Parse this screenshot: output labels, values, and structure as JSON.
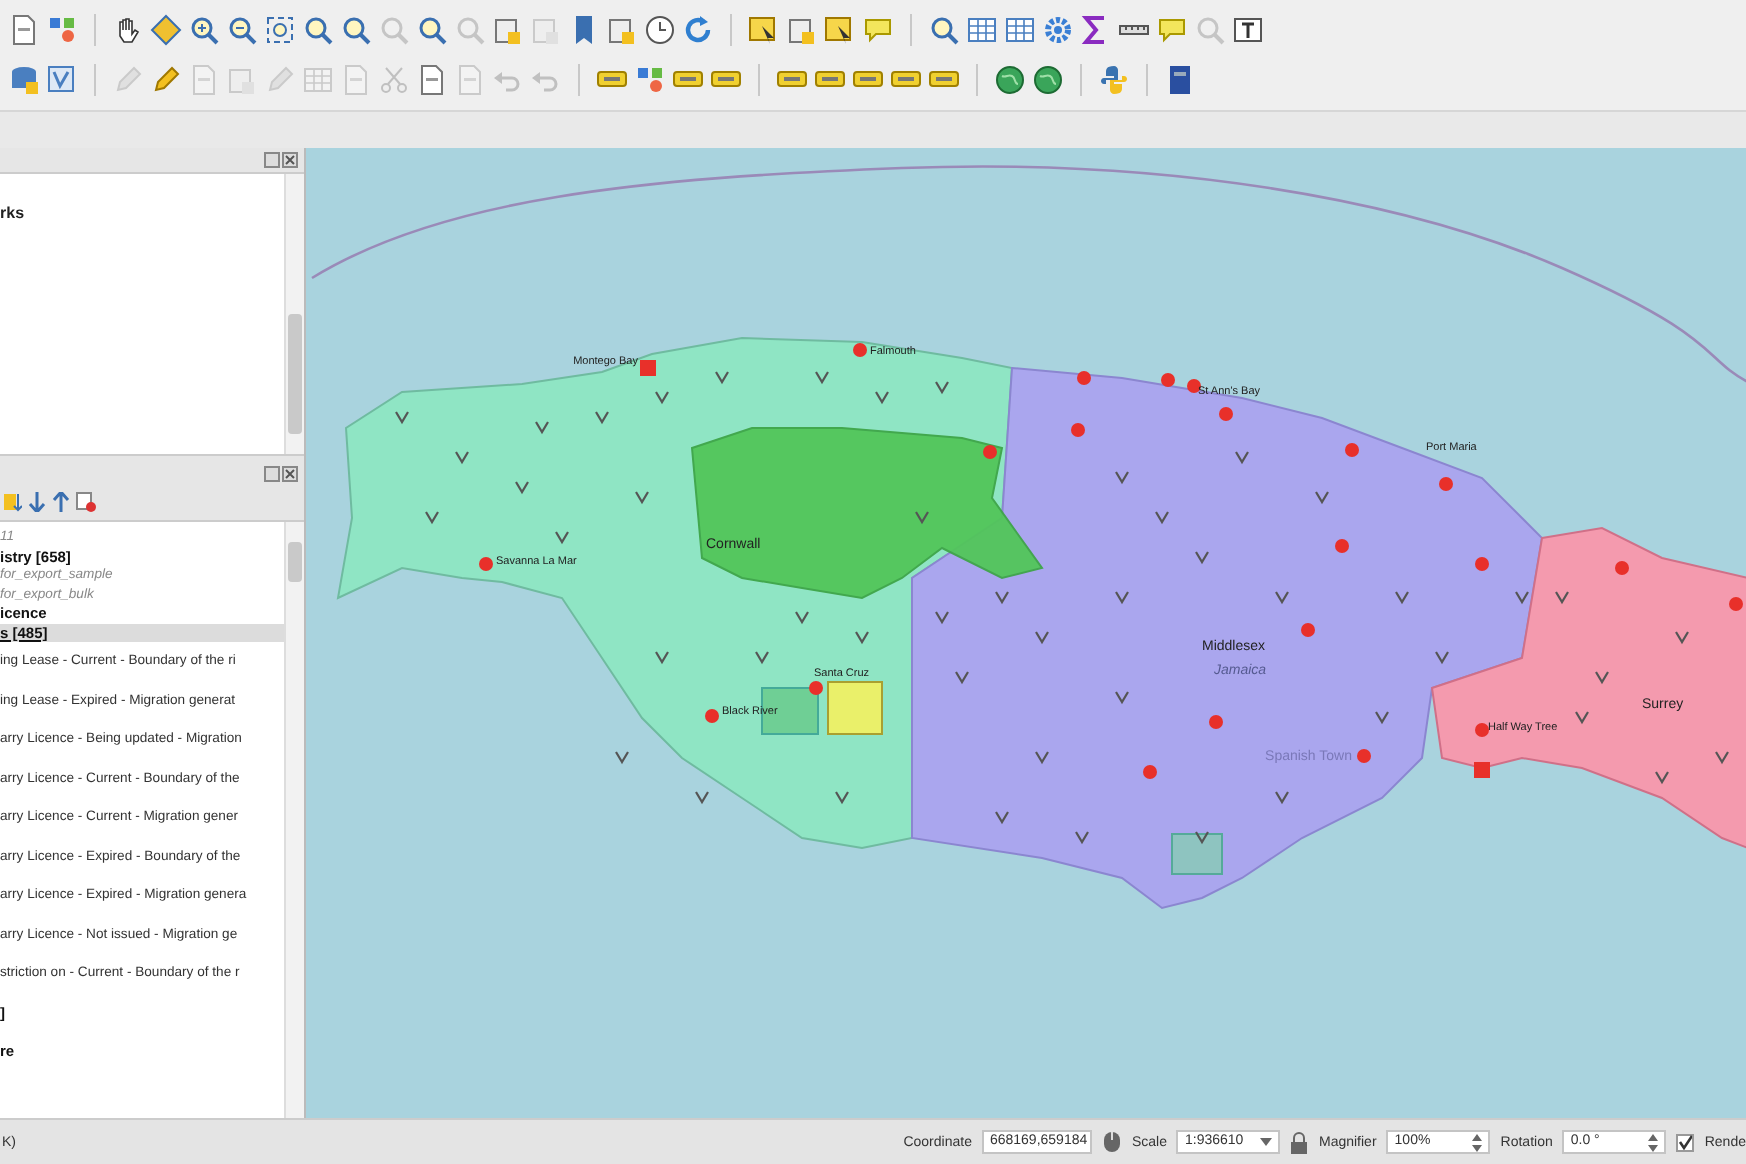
{
  "toolbars": [
    [
      {
        "kind": "page",
        "disabled": false
      },
      {
        "kind": "style",
        "disabled": false
      },
      {
        "kind": "separator"
      },
      {
        "kind": "hand",
        "disabled": false
      },
      {
        "kind": "diamond",
        "disabled": false
      },
      {
        "kind": "zoom-in",
        "disabled": false
      },
      {
        "kind": "zoom-out",
        "disabled": false
      },
      {
        "kind": "extent",
        "disabled": false
      },
      {
        "kind": "mag",
        "disabled": false
      },
      {
        "kind": "mag",
        "disabled": false
      },
      {
        "kind": "mag",
        "disabled": true
      },
      {
        "kind": "mag",
        "disabled": false
      },
      {
        "kind": "mag",
        "disabled": true
      },
      {
        "kind": "layer",
        "disabled": false
      },
      {
        "kind": "layer",
        "disabled": true
      },
      {
        "kind": "bookmark",
        "disabled": false
      },
      {
        "kind": "layer",
        "disabled": false
      },
      {
        "kind": "clock",
        "disabled": false
      },
      {
        "kind": "refresh",
        "disabled": false
      },
      {
        "kind": "separator"
      },
      {
        "kind": "select",
        "disabled": false
      },
      {
        "kind": "layer",
        "disabled": false
      },
      {
        "kind": "select",
        "disabled": false
      },
      {
        "kind": "bubble",
        "disabled": false
      },
      {
        "kind": "separator"
      },
      {
        "kind": "info",
        "disabled": false
      },
      {
        "kind": "table",
        "disabled": false
      },
      {
        "kind": "table",
        "disabled": false
      },
      {
        "kind": "gear",
        "disabled": false
      },
      {
        "kind": "sigma",
        "disabled": false
      },
      {
        "kind": "ruler",
        "disabled": false
      },
      {
        "kind": "bubble",
        "disabled": false
      },
      {
        "kind": "mag",
        "disabled": true
      },
      {
        "kind": "textbox",
        "disabled": false
      }
    ],
    [
      {
        "kind": "database",
        "disabled": false
      },
      {
        "kind": "vector",
        "disabled": false
      },
      {
        "kind": "separator"
      },
      {
        "kind": "pencil",
        "disabled": true
      },
      {
        "kind": "pencil",
        "disabled": false
      },
      {
        "kind": "page",
        "disabled": true
      },
      {
        "kind": "layer",
        "disabled": true
      },
      {
        "kind": "pencil",
        "disabled": true
      },
      {
        "kind": "table",
        "disabled": true
      },
      {
        "kind": "page",
        "disabled": true
      },
      {
        "kind": "scissors",
        "disabled": true
      },
      {
        "kind": "page",
        "disabled": false
      },
      {
        "kind": "page",
        "disabled": true
      },
      {
        "kind": "undo",
        "disabled": true
      },
      {
        "kind": "undo",
        "disabled": true
      },
      {
        "kind": "separator"
      },
      {
        "kind": "tag",
        "disabled": false
      },
      {
        "kind": "style",
        "disabled": false
      },
      {
        "kind": "tag",
        "disabled": false
      },
      {
        "kind": "tag",
        "disabled": false
      },
      {
        "kind": "separator"
      },
      {
        "kind": "tag",
        "disabled": false
      },
      {
        "kind": "tag",
        "disabled": false
      },
      {
        "kind": "tag",
        "disabled": false
      },
      {
        "kind": "tag",
        "disabled": false
      },
      {
        "kind": "tag",
        "disabled": false
      },
      {
        "kind": "separator"
      },
      {
        "kind": "globe",
        "disabled": false
      },
      {
        "kind": "globe",
        "disabled": false
      },
      {
        "kind": "separator"
      },
      {
        "kind": "python",
        "disabled": false
      },
      {
        "kind": "separator"
      },
      {
        "kind": "book",
        "disabled": false
      }
    ]
  ],
  "browser_panel": {
    "items": [
      {
        "text": "rks"
      }
    ]
  },
  "layers_panel": {
    "items": [
      {
        "text": "11",
        "bold": false,
        "italic": true,
        "selected": false
      },
      {
        "text": "istry [658]",
        "bold": true,
        "italic": false,
        "selected": false
      },
      {
        "text": "for_export_sample",
        "bold": false,
        "italic": true,
        "selected": false
      },
      {
        "text": "for_export_bulk",
        "bold": false,
        "italic": true,
        "selected": false
      },
      {
        "text": "icence",
        "bold": true,
        "italic": false,
        "selected": false
      },
      {
        "text": "s [485]",
        "bold": true,
        "italic": false,
        "selected": true
      },
      {
        "text": "ing Lease - Current - Boundary of the ri",
        "bold": false,
        "italic": false,
        "selected": false
      },
      {
        "text": "ing Lease - Expired - Migration generat",
        "bold": false,
        "italic": false,
        "selected": false
      },
      {
        "text": "arry Licence - Being updated - Migration",
        "bold": false,
        "italic": false,
        "selected": false
      },
      {
        "text": "arry Licence - Current - Boundary of the",
        "bold": false,
        "italic": false,
        "selected": false
      },
      {
        "text": "arry Licence - Current - Migration gener",
        "bold": false,
        "italic": false,
        "selected": false
      },
      {
        "text": "arry Licence - Expired - Boundary of the",
        "bold": false,
        "italic": false,
        "selected": false
      },
      {
        "text": "arry Licence - Expired - Migration genera",
        "bold": false,
        "italic": false,
        "selected": false
      },
      {
        "text": "arry Licence - Not issued - Migration ge",
        "bold": false,
        "italic": false,
        "selected": false
      },
      {
        "text": "striction on - Current - Boundary of the r",
        "bold": false,
        "italic": false,
        "selected": false
      },
      {
        "text": "]",
        "bold": true,
        "italic": false,
        "selected": false
      },
      {
        "text": "re",
        "bold": true,
        "italic": false,
        "selected": false
      }
    ]
  },
  "map": {
    "labels": [
      {
        "text": "Montego Bay",
        "kind": "town"
      },
      {
        "text": "Falmouth",
        "kind": "town"
      },
      {
        "text": "Savanna La Mar",
        "kind": "town"
      },
      {
        "text": "Cornwall",
        "kind": "county"
      },
      {
        "text": "Santa Cruz",
        "kind": "town"
      },
      {
        "text": "Black River",
        "kind": "town"
      },
      {
        "text": "St Ann's Bay",
        "kind": "town"
      },
      {
        "text": "Port Maria",
        "kind": "town"
      },
      {
        "text": "Middlesex",
        "kind": "county"
      },
      {
        "text": "Jamaica",
        "kind": "country"
      },
      {
        "text": "Spanish Town",
        "kind": "faint"
      },
      {
        "text": "Half Way Tree",
        "kind": "town"
      },
      {
        "text": "Surrey",
        "kind": "county"
      }
    ]
  },
  "status_bar": {
    "message": "K)",
    "coordinate_label": "Coordinate",
    "coordinate": "668169,659184",
    "scale_label": "Scale",
    "scale": "1:936610",
    "magnifier_label": "Magnifier",
    "magnifier": "100%",
    "rotation_label": "Rotation",
    "rotation": "0.0 °",
    "render_label": "Rende",
    "render_checked": true
  }
}
